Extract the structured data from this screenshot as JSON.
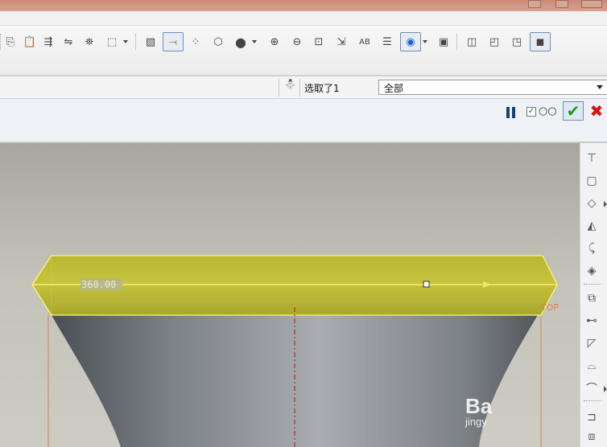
{
  "window": {
    "controls": [
      "minimize-icon",
      "maximize-icon",
      "close-icon"
    ]
  },
  "toolbar": {
    "icons": [
      "copy-icon",
      "paste-icon",
      "paste-special-icon",
      "mirror-icon",
      "find-icon",
      "selection-box-icon",
      "datum-plane-display-icon",
      "datum-axis-display-icon",
      "datum-point-display-icon",
      "coordinate-system-display-icon",
      "shading-icon",
      "zoom-in-icon",
      "zoom-out-icon",
      "refit-icon",
      "reorient-icon",
      "annotation-display-icon",
      "layers-icon",
      "spin-center-icon",
      "view-manager-icon",
      "wireframe-icon",
      "hidden-line-icon",
      "no-hidden-icon",
      "shaded-icon"
    ]
  },
  "dashboard": {
    "selection_label": "选取了1",
    "filter_value": "全部"
  },
  "model": {
    "dimension": "360.00",
    "plane_label": "TOP",
    "colors": {
      "highlight": "#c4c13a",
      "edge": "#fff67a",
      "body": "#6e7378",
      "axis": "#cc2222",
      "datum": "#d9824a"
    }
  },
  "right_toolbar": {
    "icons": [
      "rib-icon",
      "shell-icon",
      "draft-icon",
      "round-icon",
      "chamfer-icon",
      "pattern-icon",
      "mirror-tool-icon",
      "merge-icon",
      "trim-icon",
      "offset-icon",
      "thicken-icon",
      "solidify-icon",
      "extend-icon",
      "intersect-icon",
      "project-icon"
    ]
  },
  "watermark": {
    "line1": "Ba",
    "line2": "jingy"
  }
}
